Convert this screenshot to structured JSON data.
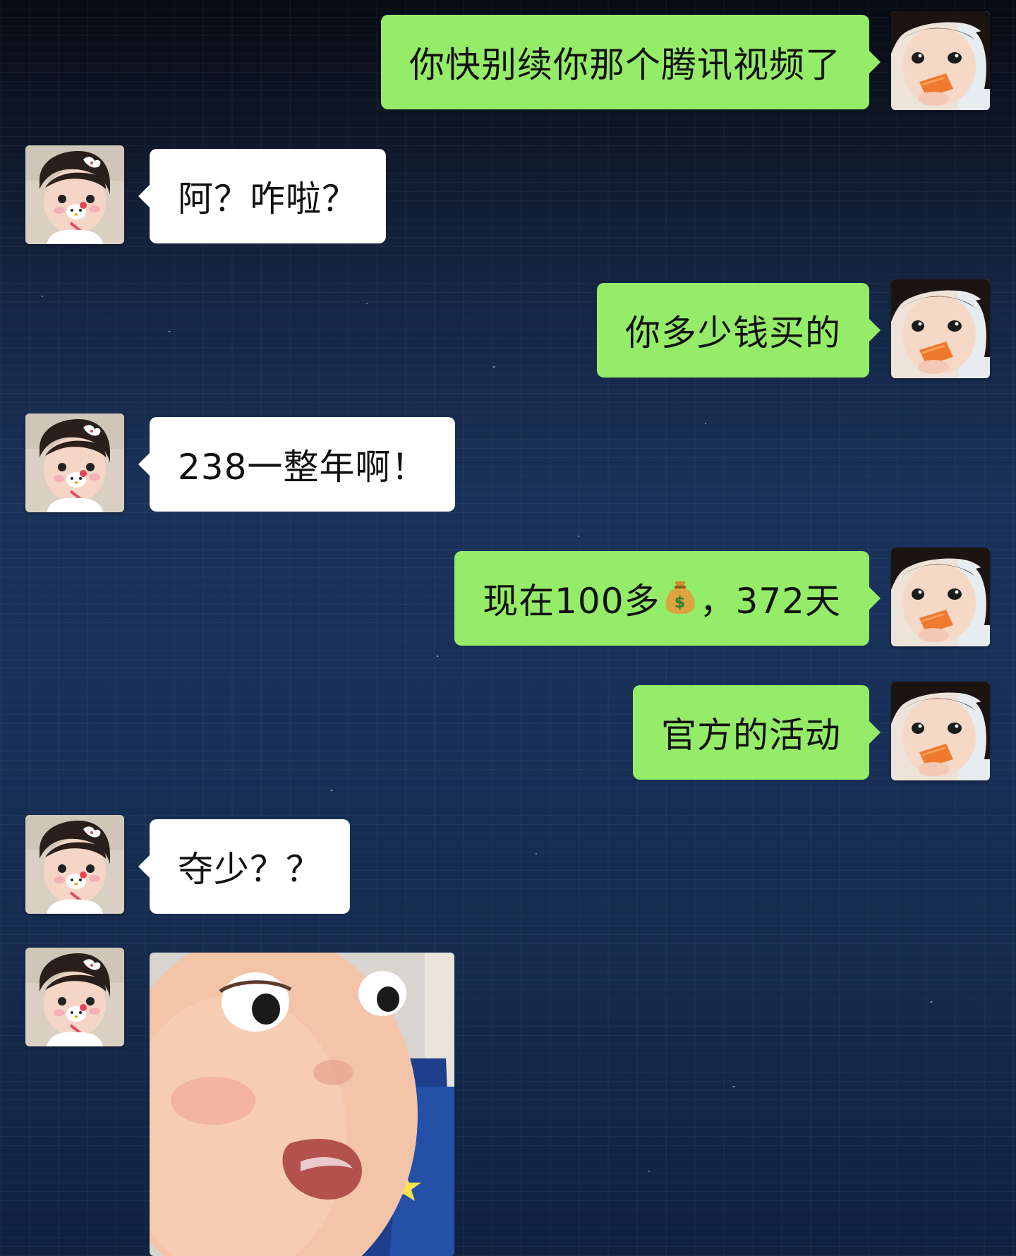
{
  "messages": [
    {
      "side": "right",
      "text": "你快别续你那个腾讯视频了"
    },
    {
      "side": "left",
      "text": "阿？咋啦？"
    },
    {
      "side": "right",
      "text": "你多少钱买的"
    },
    {
      "side": "left",
      "text": "238一整年啊！"
    },
    {
      "side": "right",
      "text_before": "现在100多",
      "text_after": "，372天",
      "emoji": "money-bag-icon"
    },
    {
      "side": "right",
      "text": "官方的活动"
    },
    {
      "side": "left",
      "text": "夺少？？"
    },
    {
      "side": "left",
      "sticker": "surprised-baby-sticker"
    }
  ],
  "colors": {
    "self_bubble": "#95ec69",
    "other_bubble": "#ffffff"
  }
}
